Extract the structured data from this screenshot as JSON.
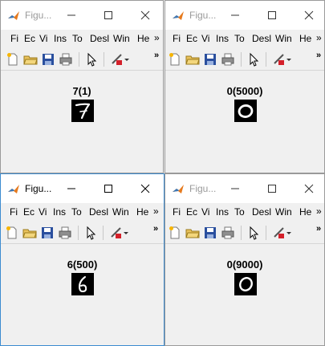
{
  "windows": [
    {
      "title": "Figu...",
      "menu": [
        "Fi",
        "Ec",
        "Vi",
        "Ins",
        "To",
        "Desl",
        "Win",
        "He"
      ],
      "menu_more": "»",
      "toolbar_more": "»",
      "plot_title": "7(1)",
      "digit": "7",
      "active": false
    },
    {
      "title": "Figu...",
      "menu": [
        "Fi",
        "Ec",
        "Vi",
        "Ins",
        "To",
        "Desl",
        "Win",
        "He"
      ],
      "menu_more": "»",
      "toolbar_more": "»",
      "plot_title": "0(5000)",
      "digit": "0",
      "active": false
    },
    {
      "title": "Figu...",
      "menu": [
        "Fi",
        "Ec",
        "Vi",
        "Ins",
        "To",
        "Desl",
        "Win",
        "He"
      ],
      "menu_more": "»",
      "toolbar_more": "»",
      "plot_title": "6(500)",
      "digit": "6",
      "active": true
    },
    {
      "title": "Figu...",
      "menu": [
        "Fi",
        "Ec",
        "Vi",
        "Ins",
        "To",
        "Desl",
        "Win",
        "He"
      ],
      "menu_more": "»",
      "toolbar_more": "»",
      "plot_title": "0(9000)",
      "digit": "0",
      "active": false
    }
  ],
  "toolbar_icons": [
    "new-figure-icon",
    "open-folder-icon",
    "save-icon",
    "print-icon",
    "pointer-icon",
    "brush-icon",
    "dropdown-arrow-icon"
  ],
  "colors": {
    "active_border": "#3c8bd0",
    "title_text": "#9a9a9a",
    "window_bg": "#f0f0f0",
    "brush_red": "#d4202a"
  }
}
